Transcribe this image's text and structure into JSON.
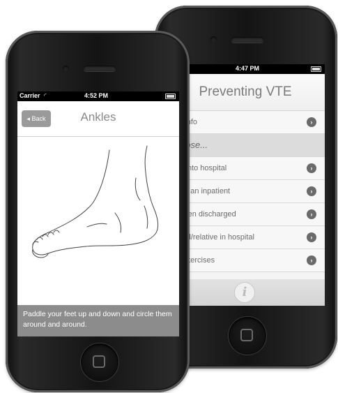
{
  "back_phone": {
    "status": {
      "time": "4:47 PM"
    },
    "title": "Preventing VTE",
    "rows": [
      {
        "label": "ground info",
        "type": "item"
      },
      {
        "label": "se choose...",
        "type": "section"
      },
      {
        "label": "coming into hospital",
        "type": "item"
      },
      {
        "label": "currently an inpatient",
        "type": "item"
      },
      {
        "label": "e just been discharged",
        "type": "item"
      },
      {
        "label": "e a friend/relative in hospital",
        "type": "item"
      },
      {
        "label": "t to do exercises",
        "type": "item"
      }
    ],
    "info_icon": "i"
  },
  "front_phone": {
    "status": {
      "carrier": "Carrier",
      "time": "4:52 PM"
    },
    "back_label": "◂ Back",
    "title": "Ankles",
    "illustration": "foot-illustration",
    "caption": "Paddle your feet up and down and circle them around and around."
  }
}
